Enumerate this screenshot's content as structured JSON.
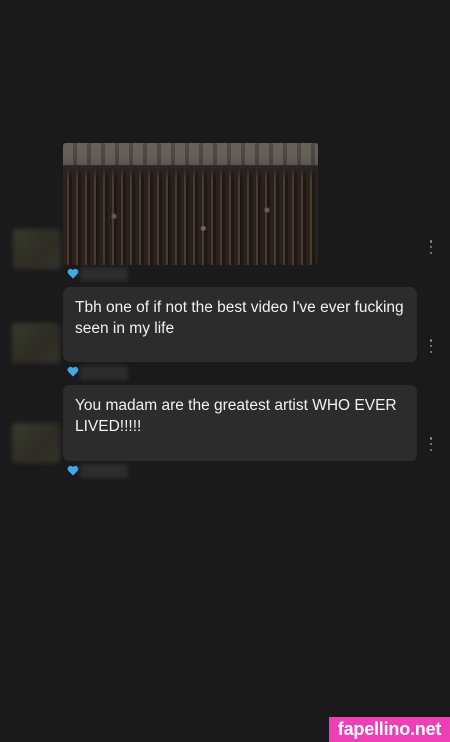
{
  "comments": [
    {
      "type": "media",
      "liked": true,
      "menu_icon": "more-vertical-icon"
    },
    {
      "type": "text",
      "text": "Tbh one of if not the best video I've ever fucking seen in my life",
      "liked": true,
      "menu_icon": "more-vertical-icon"
    },
    {
      "type": "text",
      "text": "You madam are the greatest artist WHO EVER LIVED!!!!!",
      "liked": true,
      "menu_icon": "more-vertical-icon"
    }
  ],
  "colors": {
    "background": "#1a1a1c",
    "bubble": "#2b2c2e",
    "heart": "#3fa9e8",
    "watermark_bg": "#ee3fb7"
  },
  "watermark": {
    "text": "fapellino.net"
  }
}
